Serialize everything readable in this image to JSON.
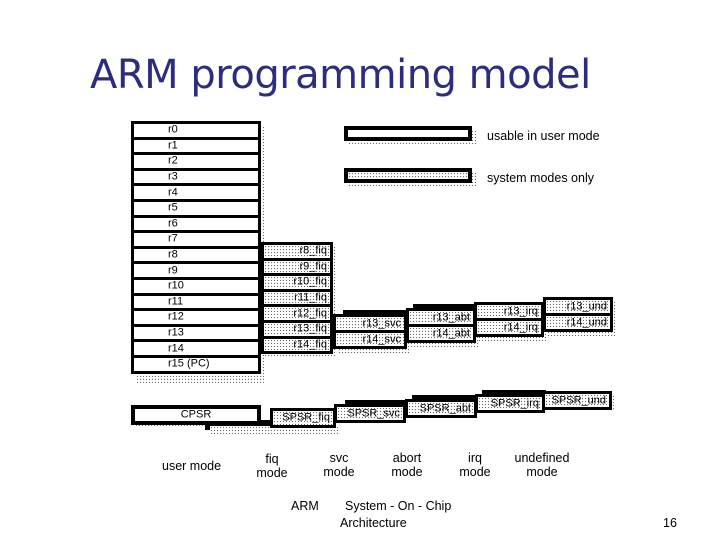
{
  "title": "ARM programming model",
  "legend": {
    "user": "usable in user mode",
    "system": "system modes only"
  },
  "user_registers": [
    "r0",
    "r1",
    "r2",
    "r3",
    "r4",
    "r5",
    "r6",
    "r7",
    "r8",
    "r9",
    "r10",
    "r11",
    "r12",
    "r13",
    "r14",
    "r15 (PC)"
  ],
  "fiq_registers": [
    "r8_fiq",
    "r9_fiq",
    "r10_fiq",
    "r11_fiq",
    "r12_fiq",
    "r13_fiq",
    "r14_fiq"
  ],
  "svc_registers": [
    "r13_svc",
    "r14_svc"
  ],
  "abt_registers": [
    "r13_abt",
    "r14_abt"
  ],
  "irq_registers": [
    "r13_irq",
    "r14_irq"
  ],
  "und_registers": [
    "r13_und",
    "r14_und"
  ],
  "status_registers": {
    "cpsr": "CPSR",
    "spsr_fiq": "SPSR_fiq",
    "spsr_svc": "SPSR_svc",
    "spsr_abt": "SPSR_abt",
    "spsr_irq": "SPSR_irq",
    "spsr_und": "SPSR_und"
  },
  "modes": {
    "user": "user mode",
    "fiq": [
      "fiq",
      "mode"
    ],
    "svc": [
      "svc",
      "mode"
    ],
    "abort": [
      "abort",
      "mode"
    ],
    "irq": [
      "irq",
      "mode"
    ],
    "undefined": [
      "undefined",
      "mode"
    ]
  },
  "footer": {
    "left": "ARM",
    "center_line1": "System - On - Chip",
    "center_line2": "Architecture",
    "page_number": "16"
  },
  "colors": {
    "title": "#2d2d7f",
    "border": "#000000"
  }
}
